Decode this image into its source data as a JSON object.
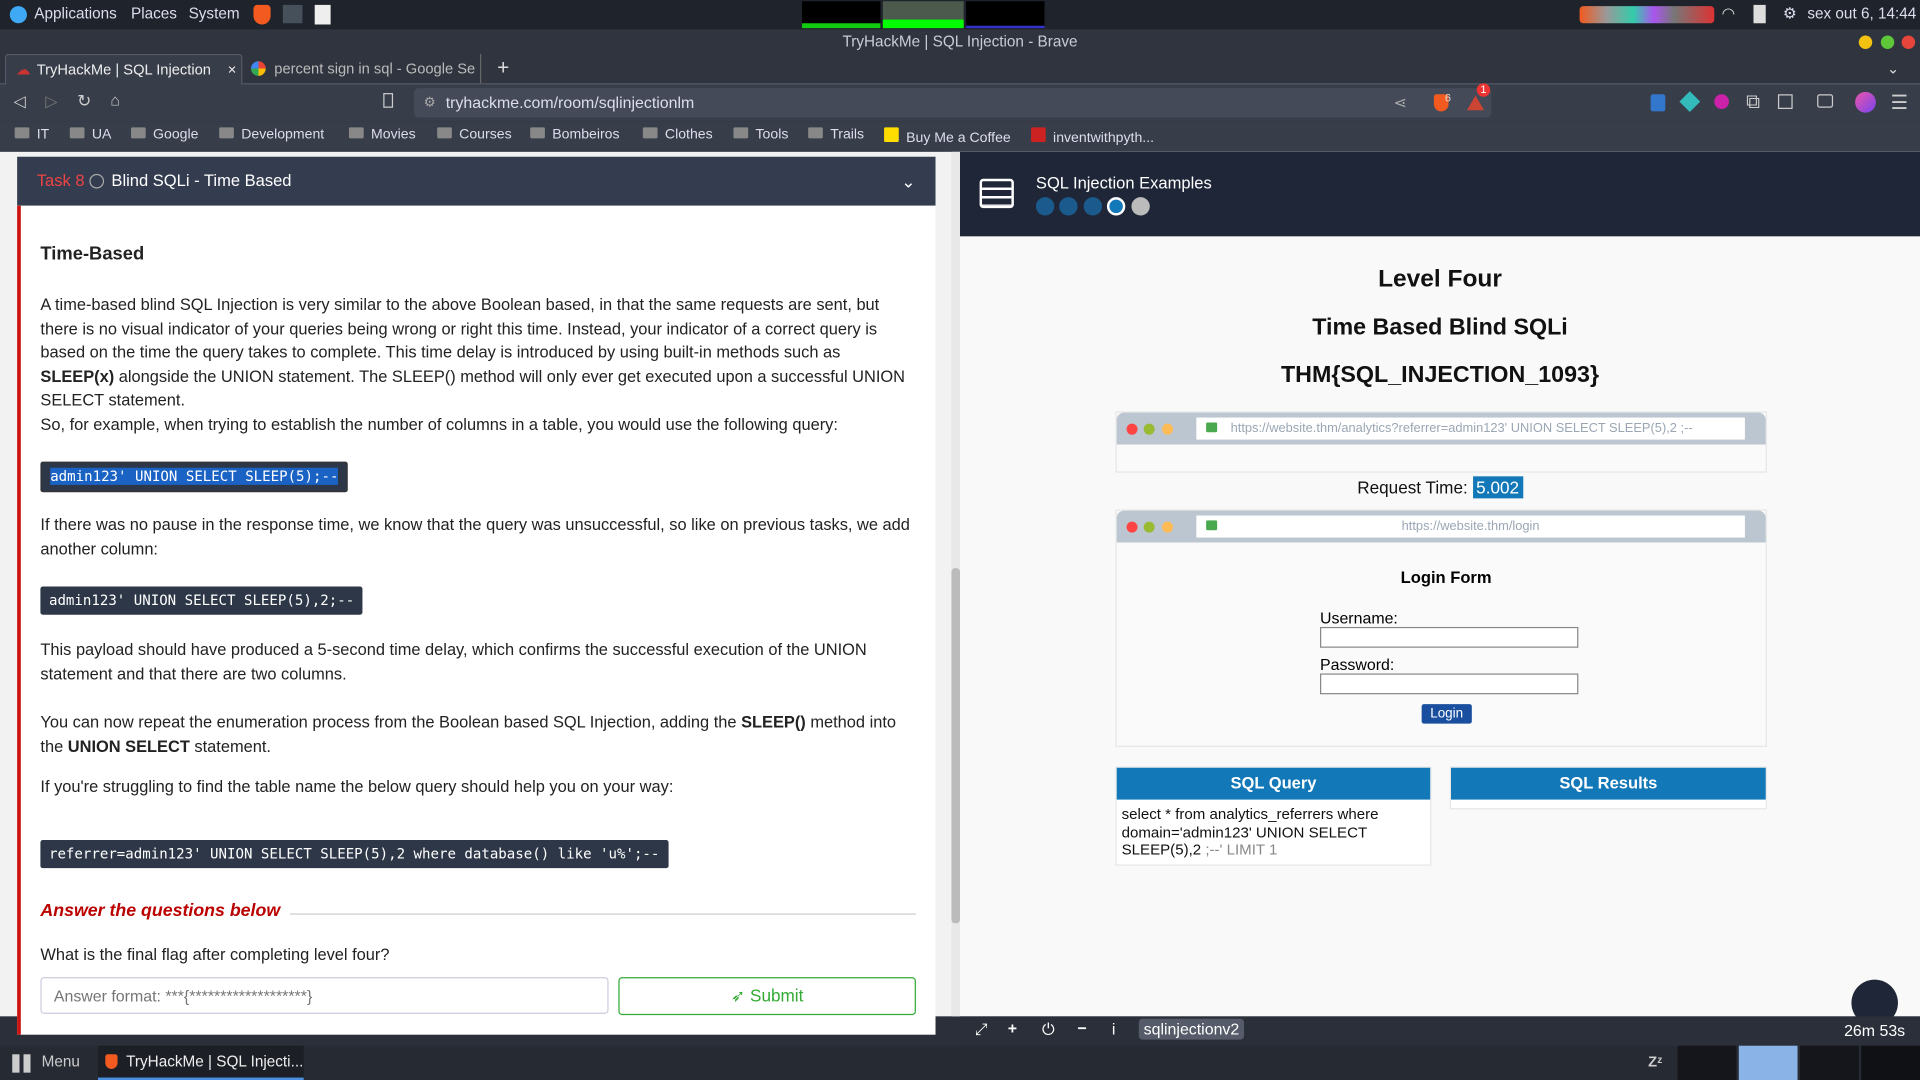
{
  "system_bar": {
    "menus": [
      "Applications",
      "Places",
      "System"
    ],
    "clock": "sex out  6, 14:44"
  },
  "window_title": "TryHackMe | SQL Injection - Brave",
  "tabs": [
    {
      "label": "TryHackMe | SQL Injection",
      "close": "×"
    },
    {
      "label": "percent sign in sql - Google Se"
    }
  ],
  "new_tab": "+",
  "address": "tryhackme.com/room/sqlinjectionlm",
  "shield_count": "6",
  "rewards_count": "1",
  "bookmarks": [
    "IT",
    "UA",
    "Google",
    "Development",
    "Movies",
    "Courses",
    "Bombeiros",
    "Clothes",
    "Tools",
    "Trails",
    "Buy Me a Coffee",
    "inventwithpyth..."
  ],
  "task": {
    "number": "Task 8",
    "title": "Blind SQLi - Time Based",
    "heading": "Time-Based",
    "p1_a": "A time-based blind SQL Injection is very similar to the above Boolean based, in that the same requests are sent, but there is no visual indicator of your queries being wrong or right this time. Instead, your indicator of a correct query is based on the time the query takes to complete. This time delay is introduced by using built-in methods such as ",
    "p1_b": "SLEEP(x)",
    "p1_c": " alongside the UNION statement. The SLEEP() method will only ever get executed upon a successful UNION SELECT statement.",
    "p2": "So, for example, when trying to establish the number of columns in a table, you would use the following query:",
    "code1": "admin123' UNION SELECT SLEEP(5);--",
    "p3": "If there was no pause in the response time, we know that the query was unsuccessful, so like on previous tasks, we add another column:",
    "code2": "admin123' UNION SELECT SLEEP(5),2;--",
    "p4": "This payload should have produced a 5-second time delay, which confirms the successful execution of the UNION statement and that there are two columns.",
    "p5_a": "You can now repeat the enumeration process from the Boolean based SQL Injection, adding the ",
    "p5_b": "SLEEP()",
    "p5_c": " method into the ",
    "p5_d": "UNION SELECT",
    "p5_e": " statement.",
    "p6": "If you're struggling to find the table name the below query should help you on your way:",
    "code3": "referrer=admin123' UNION SELECT SLEEP(5),2 where database() like 'u%';--",
    "answer_heading": "Answer the questions below",
    "question": "What is the final flag after completing level four?",
    "answer_placeholder": "Answer format: ***{*******************}",
    "submit": "Submit"
  },
  "lab": {
    "title": "SQL Injection Examples",
    "level": "Level Four",
    "subtitle": "Time Based Blind SQLi",
    "flag": "THM{SQL_INJECTION_1093}",
    "analytics_url": "https://website.thm/analytics?referrer=admin123' UNION SELECT SLEEP(5),2 ;--",
    "request_time_label": "Request Time:",
    "request_time": "5.002",
    "login_url": "https://website.thm/login",
    "login_title": "Login Form",
    "username_label": "Username:",
    "password_label": "Password:",
    "login_button": "Login",
    "sql_query_head": "SQL Query",
    "sql_query_a": "select * from analytics_referrers where domain='admin123' UNION SELECT SLEEP(5),2 ",
    "sql_query_b": ";--' LIMIT 1",
    "sql_results_head": "SQL Results"
  },
  "vm_bar": {
    "machine": "sqlinjectionv2",
    "timer": "26m 53s"
  },
  "taskbar": {
    "menu": "Menu",
    "window": "TryHackMe | SQL Injecti..."
  }
}
